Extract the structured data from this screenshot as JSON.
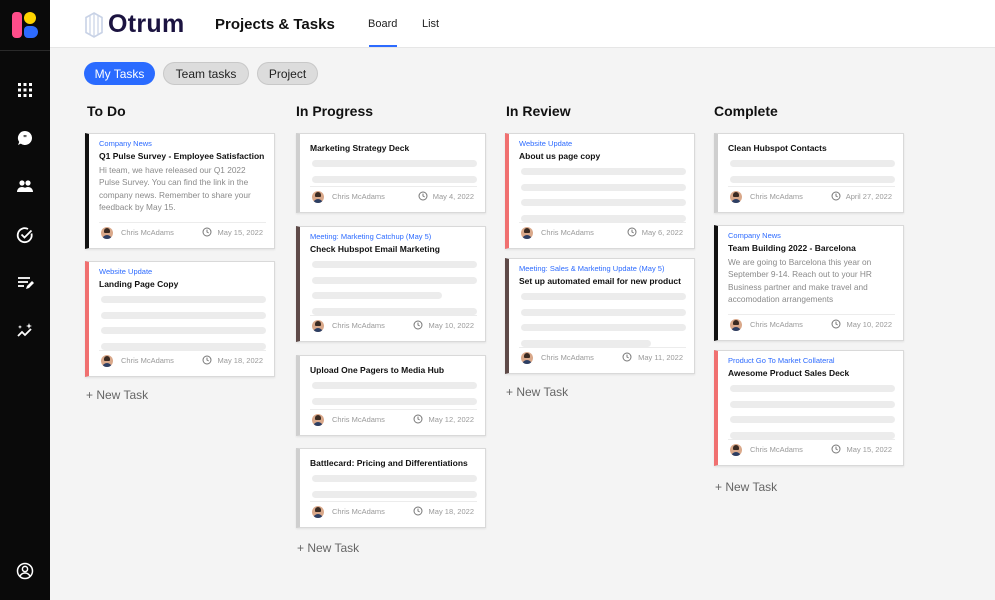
{
  "app": {
    "name": "Otrum",
    "page_title": "Projects & Tasks"
  },
  "colors": {
    "accent": "#2a6bff",
    "tag_blue": "#2d6bff",
    "accent_red": "#f07070",
    "accent_black": "#111111",
    "accent_brown": "#5e4a48",
    "accent_gray": "#cfcfcf"
  },
  "sidebar": {
    "icons": [
      "grid-icon",
      "chat-icon",
      "people-icon",
      "check-circle-icon",
      "edit-list-icon",
      "sparkle-icon",
      "user-circle-icon"
    ]
  },
  "tabs": [
    {
      "label": "Board",
      "active": true
    },
    {
      "label": "List",
      "active": false
    }
  ],
  "filters": [
    {
      "label": "My Tasks",
      "active": true
    },
    {
      "label": "Team tasks",
      "active": false
    },
    {
      "label": "Project",
      "active": false
    }
  ],
  "columns": [
    {
      "title": "To Do",
      "new_task": "+ New Task",
      "cards": [
        {
          "tag": "Company News",
          "title": "Q1 Pulse Survey - Employee Satisfaction",
          "description": "Hi team, we have released our Q1 2022 Pulse Survey. You can find the link in the company news. Remember to share your feedback by May 15.",
          "author": "Chris McAdams",
          "date": "May 15, 2022",
          "accent": "#111111"
        },
        {
          "tag": "Website Update",
          "title": "Landing Page Copy",
          "description": "",
          "author": "Chris McAdams",
          "date": "May 18, 2022",
          "accent": "#f07070"
        }
      ]
    },
    {
      "title": "In Progress",
      "new_task": "+ New Task",
      "cards": [
        {
          "tag": "",
          "title": "Marketing Strategy Deck",
          "description": "",
          "author": "Chris McAdams",
          "date": "May 4, 2022",
          "accent": "#cfcfcf"
        },
        {
          "tag": "Meeting: Marketing Catchup (May 5)",
          "title": "Check Hubspot Email Marketing",
          "description": "",
          "author": "Chris McAdams",
          "date": "May 10, 2022",
          "accent": "#5e4a48"
        },
        {
          "tag": "",
          "title": "Upload One Pagers to Media Hub",
          "description": "",
          "author": "Chris McAdams",
          "date": "May 12, 2022",
          "accent": "#cfcfcf"
        },
        {
          "tag": "",
          "title": "Battlecard: Pricing and Differentiations",
          "description": "",
          "author": "Chris McAdams",
          "date": "May 18, 2022",
          "accent": "#cfcfcf"
        }
      ]
    },
    {
      "title": "In Review",
      "new_task": "+ New Task",
      "cards": [
        {
          "tag": "Website Update",
          "title": "About us page copy",
          "description": "",
          "author": "Chris McAdams",
          "date": "May 6, 2022",
          "accent": "#f07070"
        },
        {
          "tag": "Meeting: Sales & Marketing Update (May 5)",
          "title": "Set up automated email for new product",
          "description": "",
          "author": "Chris McAdams",
          "date": "May 11, 2022",
          "accent": "#5e4a48"
        }
      ]
    },
    {
      "title": "Complete",
      "new_task": "+ New Task",
      "cards": [
        {
          "tag": "",
          "title": "Clean Hubspot Contacts",
          "description": "",
          "author": "Chris McAdams",
          "date": "April 27, 2022",
          "accent": "#cfcfcf"
        },
        {
          "tag": "Company News",
          "title": "Team Building 2022 - Barcelona",
          "description": "We are going to Barcelona this year on September 9-14. Reach out to your HR Business partner and make travel and accomodation arrangements",
          "author": "Chris McAdams",
          "date": "May 10, 2022",
          "accent": "#111111"
        },
        {
          "tag": "Product Go To Market Collateral",
          "title": "Awesome Product Sales Deck",
          "description": "",
          "author": "Chris McAdams",
          "date": "May 15, 2022",
          "accent": "#f07070"
        }
      ]
    }
  ]
}
